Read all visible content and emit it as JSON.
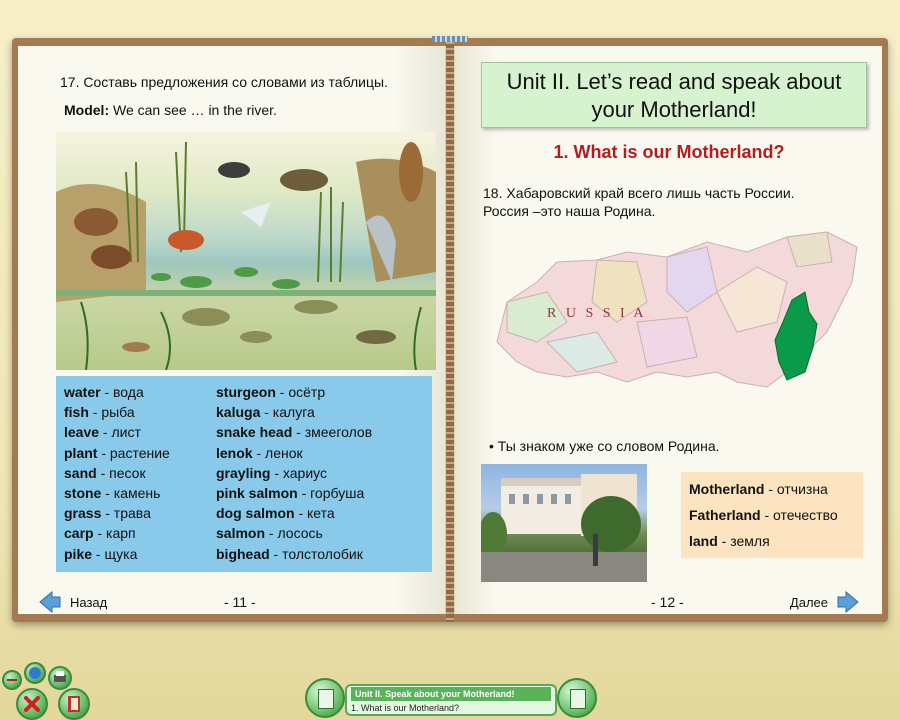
{
  "left_page": {
    "task_title": "17. Составь предложения со словами из таблицы.",
    "model_label": "Model:",
    "model_text": " We can see … in the river.",
    "vocab_col1": [
      {
        "en": "water",
        "ru": " - вода"
      },
      {
        "en": "fish",
        "ru": " - рыба"
      },
      {
        "en": "leave",
        "ru": " - лист"
      },
      {
        "en": "plant",
        "ru": " - растение"
      },
      {
        "en": "sand",
        "ru": " - песок"
      },
      {
        "en": "stone",
        "ru": " - камень"
      },
      {
        "en": "grass",
        "ru": " - трава"
      },
      {
        "en": "carp",
        "ru": " - карп"
      },
      {
        "en": "pike",
        "ru": " - щука"
      }
    ],
    "vocab_col2": [
      {
        "en": "sturgeon",
        "ru": " - осётр"
      },
      {
        "en": "kaluga",
        "ru": " - калуга"
      },
      {
        "en": "snake head",
        "ru": " - змееголов"
      },
      {
        "en": "lenok",
        "ru": " - ленок"
      },
      {
        "en": "grayling",
        "ru": " - хариус"
      },
      {
        "en": "pink salmon",
        "ru": " - горбуша"
      },
      {
        "en": "dog salmon",
        "ru": " - кета"
      },
      {
        "en": "salmon",
        "ru": " - лосось"
      },
      {
        "en": "bighead",
        "ru": " - толстолобик"
      }
    ],
    "back_label": "Назад",
    "page_number": "- 11 -"
  },
  "right_page": {
    "unit_title_line1": "Unit II. Let’s read and speak about",
    "unit_title_line2": "your Motherland!",
    "section_title": "1. What is our Motherland?",
    "task18_line1": "18. Хабаровский край всего лишь часть России.",
    "task18_line2": "Россия –это наша Родина.",
    "map_label": "R U S S I A",
    "bullet_text": "• Ты знаком уже со словом Родина.",
    "words": [
      {
        "en": "Motherland",
        "ru": " - отчизна"
      },
      {
        "en": "Fatherland",
        "ru": " - отечество"
      },
      {
        "en": "land",
        "ru": " - земля"
      }
    ],
    "next_label": "Далее",
    "page_number": "- 12 -"
  },
  "status_bar": {
    "title": "Unit II. Speak about your Motherland!",
    "subtitle": "1. What is our Motherland?"
  },
  "colors": {
    "vocab_bg": "#89c9ea",
    "unit_box_bg": "#d6f2cf",
    "section_title": "#b21e1e",
    "words_bg": "#fce4c0",
    "khabarovsk": "#0b9a4a",
    "arrow": "#5a9fd8"
  },
  "icons": {
    "back": "arrow-left-icon",
    "next": "arrow-right-icon",
    "toolbar": [
      "minus-icon",
      "info-icon",
      "print-icon",
      "close-icon",
      "book-icon"
    ]
  }
}
